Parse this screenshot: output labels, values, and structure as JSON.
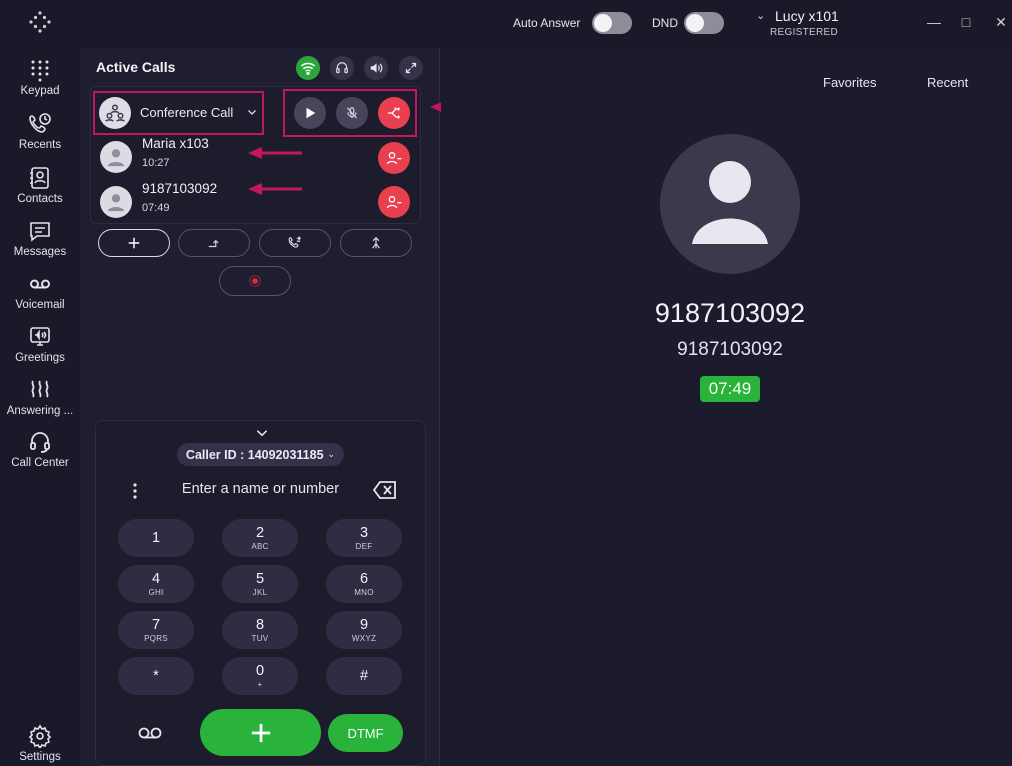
{
  "titlebar": {
    "auto_answer_label": "Auto Answer",
    "auto_answer_on": false,
    "dnd_label": "DND",
    "dnd_on": false,
    "user_name": "Lucy x101",
    "user_status": "REGISTERED"
  },
  "sidebar": {
    "items": [
      {
        "label": "Keypad",
        "icon": "keypad-icon"
      },
      {
        "label": "Recents",
        "icon": "recents-icon"
      },
      {
        "label": "Contacts",
        "icon": "contacts-icon"
      },
      {
        "label": "Messages",
        "icon": "messages-icon"
      },
      {
        "label": "Voicemail",
        "icon": "voicemail-icon"
      },
      {
        "label": "Greetings",
        "icon": "greetings-icon"
      },
      {
        "label": "Answering ...",
        "icon": "answering-rules-icon"
      },
      {
        "label": "Call Center",
        "icon": "headset-icon"
      }
    ],
    "settings_label": "Settings"
  },
  "active_calls": {
    "title": "Active Calls",
    "conference_label": "Conference Call",
    "participants": [
      {
        "name": "Maria x103",
        "duration": "10:27"
      },
      {
        "name": "9187103092",
        "duration": "07:49"
      }
    ]
  },
  "dialpad": {
    "caller_id": "Caller ID : 14092031185",
    "input_placeholder": "Enter a name or number",
    "keys": [
      {
        "digit": "1",
        "letters": ""
      },
      {
        "digit": "2",
        "letters": "ABC"
      },
      {
        "digit": "3",
        "letters": "DEF"
      },
      {
        "digit": "4",
        "letters": "GHI"
      },
      {
        "digit": "5",
        "letters": "JKL"
      },
      {
        "digit": "6",
        "letters": "MNO"
      },
      {
        "digit": "7",
        "letters": "PQRS"
      },
      {
        "digit": "8",
        "letters": "TUV"
      },
      {
        "digit": "9",
        "letters": "WXYZ"
      },
      {
        "digit": "*",
        "letters": ""
      },
      {
        "digit": "0",
        "letters": "+"
      },
      {
        "digit": "#",
        "letters": ""
      }
    ],
    "dtmf_label": "DTMF"
  },
  "right_panel": {
    "tabs": [
      "Favorites",
      "Recent"
    ],
    "number_primary": "9187103092",
    "number_secondary": "9187103092",
    "timer": "07:49"
  },
  "colors": {
    "accent_green": "#2ab33b",
    "danger_red": "#e8404e",
    "highlight": "#c2185b",
    "background": "#1c1b2e"
  }
}
